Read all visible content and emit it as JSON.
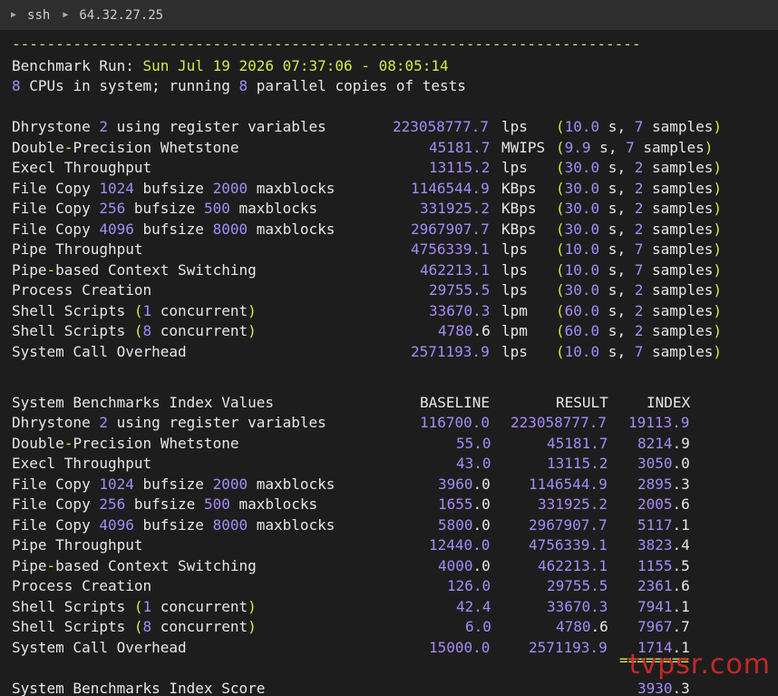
{
  "titlebar": {
    "items": [
      "ssh",
      "64.32.27.25"
    ]
  },
  "header": {
    "dash_line": "------------------------------------------------------------------------",
    "run_label": "Benchmark Run:",
    "run_date": "Sun Jul 19 2026 07:37:06 - 08:05:14",
    "cpus_text": [
      {
        "t": "8",
        "c": "num"
      },
      {
        "t": " CPUs in system; running ",
        "c": "wht"
      },
      {
        "t": "8",
        "c": "num"
      },
      {
        "t": " parallel copies of tests",
        "c": "wht"
      }
    ]
  },
  "tests": [
    {
      "name": [
        {
          "t": "Dhrystone ",
          "c": "wht"
        },
        {
          "t": "2",
          "c": "num"
        },
        {
          "t": " using register variables",
          "c": "wht"
        }
      ],
      "value": "223058777.7",
      "unit": "lps",
      "paren": [
        {
          "t": "(",
          "c": "pun"
        },
        {
          "t": "10.0",
          "c": "num"
        },
        {
          "t": " s, ",
          "c": "wht"
        },
        {
          "t": "7",
          "c": "num"
        },
        {
          "t": " samples",
          "c": "wht"
        },
        {
          "t": ")",
          "c": "pun"
        }
      ]
    },
    {
      "name": [
        {
          "t": "Double",
          "c": "wht"
        },
        {
          "t": "-",
          "c": "pun"
        },
        {
          "t": "Precision Whetstone",
          "c": "wht"
        }
      ],
      "value": "45181.7",
      "unit": "MWIPS",
      "paren": [
        {
          "t": "(",
          "c": "pun"
        },
        {
          "t": "9.9",
          "c": "num"
        },
        {
          "t": " s, ",
          "c": "wht"
        },
        {
          "t": "7",
          "c": "num"
        },
        {
          "t": " samples",
          "c": "wht"
        },
        {
          "t": ")",
          "c": "pun"
        }
      ]
    },
    {
      "name": [
        {
          "t": "Execl Throughput",
          "c": "wht"
        }
      ],
      "value": "13115.2",
      "unit": "lps",
      "paren": [
        {
          "t": "(",
          "c": "pun"
        },
        {
          "t": "30.0",
          "c": "num"
        },
        {
          "t": " s, ",
          "c": "wht"
        },
        {
          "t": "2",
          "c": "num"
        },
        {
          "t": " samples",
          "c": "wht"
        },
        {
          "t": ")",
          "c": "pun"
        }
      ]
    },
    {
      "name": [
        {
          "t": "File Copy ",
          "c": "wht"
        },
        {
          "t": "1024",
          "c": "num"
        },
        {
          "t": " bufsize ",
          "c": "wht"
        },
        {
          "t": "2000",
          "c": "num"
        },
        {
          "t": " maxblocks",
          "c": "wht"
        }
      ],
      "value": "1146544.9",
      "unit": "KBps",
      "paren": [
        {
          "t": "(",
          "c": "pun"
        },
        {
          "t": "30.0",
          "c": "num"
        },
        {
          "t": " s, ",
          "c": "wht"
        },
        {
          "t": "2",
          "c": "num"
        },
        {
          "t": " samples",
          "c": "wht"
        },
        {
          "t": ")",
          "c": "pun"
        }
      ]
    },
    {
      "name": [
        {
          "t": "File Copy ",
          "c": "wht"
        },
        {
          "t": "256",
          "c": "num"
        },
        {
          "t": " bufsize ",
          "c": "wht"
        },
        {
          "t": "500",
          "c": "num"
        },
        {
          "t": " maxblocks",
          "c": "wht"
        }
      ],
      "value": "331925.2",
      "unit": "KBps",
      "paren": [
        {
          "t": "(",
          "c": "pun"
        },
        {
          "t": "30.0",
          "c": "num"
        },
        {
          "t": " s, ",
          "c": "wht"
        },
        {
          "t": "2",
          "c": "num"
        },
        {
          "t": " samples",
          "c": "wht"
        },
        {
          "t": ")",
          "c": "pun"
        }
      ]
    },
    {
      "name": [
        {
          "t": "File Copy ",
          "c": "wht"
        },
        {
          "t": "4096",
          "c": "num"
        },
        {
          "t": " bufsize ",
          "c": "wht"
        },
        {
          "t": "8000",
          "c": "num"
        },
        {
          "t": " maxblocks",
          "c": "wht"
        }
      ],
      "value": "2967907.7",
      "unit": "KBps",
      "paren": [
        {
          "t": "(",
          "c": "pun"
        },
        {
          "t": "30.0",
          "c": "num"
        },
        {
          "t": " s, ",
          "c": "wht"
        },
        {
          "t": "2",
          "c": "num"
        },
        {
          "t": " samples",
          "c": "wht"
        },
        {
          "t": ")",
          "c": "pun"
        }
      ]
    },
    {
      "name": [
        {
          "t": "Pipe Throughput",
          "c": "wht"
        }
      ],
      "value": "4756339.1",
      "unit": "lps",
      "paren": [
        {
          "t": "(",
          "c": "pun"
        },
        {
          "t": "10.0",
          "c": "num"
        },
        {
          "t": " s, ",
          "c": "wht"
        },
        {
          "t": "7",
          "c": "num"
        },
        {
          "t": " samples",
          "c": "wht"
        },
        {
          "t": ")",
          "c": "pun"
        }
      ]
    },
    {
      "name": [
        {
          "t": "Pipe",
          "c": "wht"
        },
        {
          "t": "-",
          "c": "pun"
        },
        {
          "t": "based Context Switching",
          "c": "wht"
        }
      ],
      "value": "462213.1",
      "unit": "lps",
      "paren": [
        {
          "t": "(",
          "c": "pun"
        },
        {
          "t": "10.0",
          "c": "num"
        },
        {
          "t": " s, ",
          "c": "wht"
        },
        {
          "t": "7",
          "c": "num"
        },
        {
          "t": " samples",
          "c": "wht"
        },
        {
          "t": ")",
          "c": "pun"
        }
      ]
    },
    {
      "name": [
        {
          "t": "Process Creation",
          "c": "wht"
        }
      ],
      "value": "29755.5",
      "unit": "lps",
      "paren": [
        {
          "t": "(",
          "c": "pun"
        },
        {
          "t": "30.0",
          "c": "num"
        },
        {
          "t": " s, ",
          "c": "wht"
        },
        {
          "t": "2",
          "c": "num"
        },
        {
          "t": " samples",
          "c": "wht"
        },
        {
          "t": ")",
          "c": "pun"
        }
      ]
    },
    {
      "name": [
        {
          "t": "Shell Scripts ",
          "c": "wht"
        },
        {
          "t": "(",
          "c": "pun"
        },
        {
          "t": "1",
          "c": "num"
        },
        {
          "t": " concurrent",
          "c": "wht"
        },
        {
          "t": ")",
          "c": "pun"
        }
      ],
      "value": "33670.3",
      "unit": "lpm",
      "paren": [
        {
          "t": "(",
          "c": "pun"
        },
        {
          "t": "60.0",
          "c": "num"
        },
        {
          "t": " s, ",
          "c": "wht"
        },
        {
          "t": "2",
          "c": "num"
        },
        {
          "t": " samples",
          "c": "wht"
        },
        {
          "t": ")",
          "c": "pun"
        }
      ]
    },
    {
      "name": [
        {
          "t": "Shell Scripts ",
          "c": "wht"
        },
        {
          "t": "(",
          "c": "pun"
        },
        {
          "t": "8",
          "c": "num"
        },
        {
          "t": " concurrent",
          "c": "wht"
        },
        {
          "t": ")",
          "c": "pun"
        }
      ],
      "value": [
        {
          "t": "4780",
          "c": "num"
        },
        {
          "t": ".6",
          "c": "wht"
        }
      ],
      "unit": "lpm",
      "paren": [
        {
          "t": "(",
          "c": "pun"
        },
        {
          "t": "60.0",
          "c": "num"
        },
        {
          "t": " s, ",
          "c": "wht"
        },
        {
          "t": "2",
          "c": "num"
        },
        {
          "t": " samples",
          "c": "wht"
        },
        {
          "t": ")",
          "c": "pun"
        }
      ]
    },
    {
      "name": [
        {
          "t": "System Call Overhead",
          "c": "wht"
        }
      ],
      "value": "2571193.9",
      "unit": "lps",
      "paren": [
        {
          "t": "(",
          "c": "pun"
        },
        {
          "t": "10.0",
          "c": "num"
        },
        {
          "t": " s, ",
          "c": "wht"
        },
        {
          "t": "7",
          "c": "num"
        },
        {
          "t": " samples",
          "c": "wht"
        },
        {
          "t": ")",
          "c": "pun"
        }
      ]
    }
  ],
  "index_table": {
    "title": "System Benchmarks Index Values",
    "col_baseline": "BASELINE",
    "col_result": "RESULT",
    "col_index": "INDEX",
    "rows": [
      {
        "name": [
          {
            "t": "Dhrystone ",
            "c": "wht"
          },
          {
            "t": "2",
            "c": "num"
          },
          {
            "t": " using register variables",
            "c": "wht"
          }
        ],
        "baseline": "116700.0",
        "result": "223058777.7",
        "index": "19113.9"
      },
      {
        "name": [
          {
            "t": "Double",
            "c": "wht"
          },
          {
            "t": "-",
            "c": "pun"
          },
          {
            "t": "Precision Whetstone",
            "c": "wht"
          }
        ],
        "baseline": "55.0",
        "result": "45181.7",
        "index": [
          {
            "t": "8214",
            "c": "num"
          },
          {
            "t": ".9",
            "c": "wht"
          }
        ]
      },
      {
        "name": [
          {
            "t": "Execl Throughput",
            "c": "wht"
          }
        ],
        "baseline": "43.0",
        "result": "13115.2",
        "index": [
          {
            "t": "3050",
            "c": "num"
          },
          {
            "t": ".0",
            "c": "wht"
          }
        ]
      },
      {
        "name": [
          {
            "t": "File Copy ",
            "c": "wht"
          },
          {
            "t": "1024",
            "c": "num"
          },
          {
            "t": " bufsize ",
            "c": "wht"
          },
          {
            "t": "2000",
            "c": "num"
          },
          {
            "t": " maxblocks",
            "c": "wht"
          }
        ],
        "baseline": [
          {
            "t": "3960",
            "c": "num"
          },
          {
            "t": ".0",
            "c": "wht"
          }
        ],
        "result": "1146544.9",
        "index": [
          {
            "t": "2895",
            "c": "num"
          },
          {
            "t": ".3",
            "c": "wht"
          }
        ]
      },
      {
        "name": [
          {
            "t": "File Copy ",
            "c": "wht"
          },
          {
            "t": "256",
            "c": "num"
          },
          {
            "t": " bufsize ",
            "c": "wht"
          },
          {
            "t": "500",
            "c": "num"
          },
          {
            "t": " maxblocks",
            "c": "wht"
          }
        ],
        "baseline": [
          {
            "t": "1655",
            "c": "num"
          },
          {
            "t": ".0",
            "c": "wht"
          }
        ],
        "result": "331925.2",
        "index": [
          {
            "t": "2005",
            "c": "num"
          },
          {
            "t": ".6",
            "c": "wht"
          }
        ]
      },
      {
        "name": [
          {
            "t": "File Copy ",
            "c": "wht"
          },
          {
            "t": "4096",
            "c": "num"
          },
          {
            "t": " bufsize ",
            "c": "wht"
          },
          {
            "t": "8000",
            "c": "num"
          },
          {
            "t": " maxblocks",
            "c": "wht"
          }
        ],
        "baseline": [
          {
            "t": "5800",
            "c": "num"
          },
          {
            "t": ".0",
            "c": "wht"
          }
        ],
        "result": "2967907.7",
        "index": [
          {
            "t": "5117",
            "c": "num"
          },
          {
            "t": ".1",
            "c": "wht"
          }
        ]
      },
      {
        "name": [
          {
            "t": "Pipe Throughput",
            "c": "wht"
          }
        ],
        "baseline": "12440.0",
        "result": "4756339.1",
        "index": [
          {
            "t": "3823",
            "c": "num"
          },
          {
            "t": ".4",
            "c": "wht"
          }
        ]
      },
      {
        "name": [
          {
            "t": "Pipe",
            "c": "wht"
          },
          {
            "t": "-",
            "c": "pun"
          },
          {
            "t": "based Context Switching",
            "c": "wht"
          }
        ],
        "baseline": [
          {
            "t": "4000",
            "c": "num"
          },
          {
            "t": ".0",
            "c": "wht"
          }
        ],
        "result": "462213.1",
        "index": [
          {
            "t": "1155",
            "c": "num"
          },
          {
            "t": ".5",
            "c": "wht"
          }
        ]
      },
      {
        "name": [
          {
            "t": "Process Creation",
            "c": "wht"
          }
        ],
        "baseline": "126.0",
        "result": "29755.5",
        "index": [
          {
            "t": "2361",
            "c": "num"
          },
          {
            "t": ".6",
            "c": "wht"
          }
        ]
      },
      {
        "name": [
          {
            "t": "Shell Scripts ",
            "c": "wht"
          },
          {
            "t": "(",
            "c": "pun"
          },
          {
            "t": "1",
            "c": "num"
          },
          {
            "t": " concurrent",
            "c": "wht"
          },
          {
            "t": ")",
            "c": "pun"
          }
        ],
        "baseline": "42.4",
        "result": "33670.3",
        "index": [
          {
            "t": "7941",
            "c": "num"
          },
          {
            "t": ".1",
            "c": "wht"
          }
        ]
      },
      {
        "name": [
          {
            "t": "Shell Scripts ",
            "c": "wht"
          },
          {
            "t": "(",
            "c": "pun"
          },
          {
            "t": "8",
            "c": "num"
          },
          {
            "t": " concurrent",
            "c": "wht"
          },
          {
            "t": ")",
            "c": "pun"
          }
        ],
        "baseline": "6.0",
        "result": [
          {
            "t": "4780",
            "c": "num"
          },
          {
            "t": ".6",
            "c": "wht"
          }
        ],
        "index": [
          {
            "t": "7967",
            "c": "num"
          },
          {
            "t": ".7",
            "c": "wht"
          }
        ]
      },
      {
        "name": [
          {
            "t": "System Call Overhead",
            "c": "wht"
          }
        ],
        "baseline": "15000.0",
        "result": "2571193.9",
        "index": [
          {
            "t": "1714",
            "c": "num"
          },
          {
            "t": ".1",
            "c": "wht"
          }
        ]
      }
    ],
    "separator": "========",
    "score_label": "System Benchmarks Index Score",
    "score": "3930.3"
  },
  "watermark": "tvpsr.com",
  "colors": {
    "background": "#1d1d1d",
    "number": "#a48cf6",
    "punct": "#d6e84a",
    "text": "#e6e6e6",
    "watermark": "#e02a2a"
  }
}
